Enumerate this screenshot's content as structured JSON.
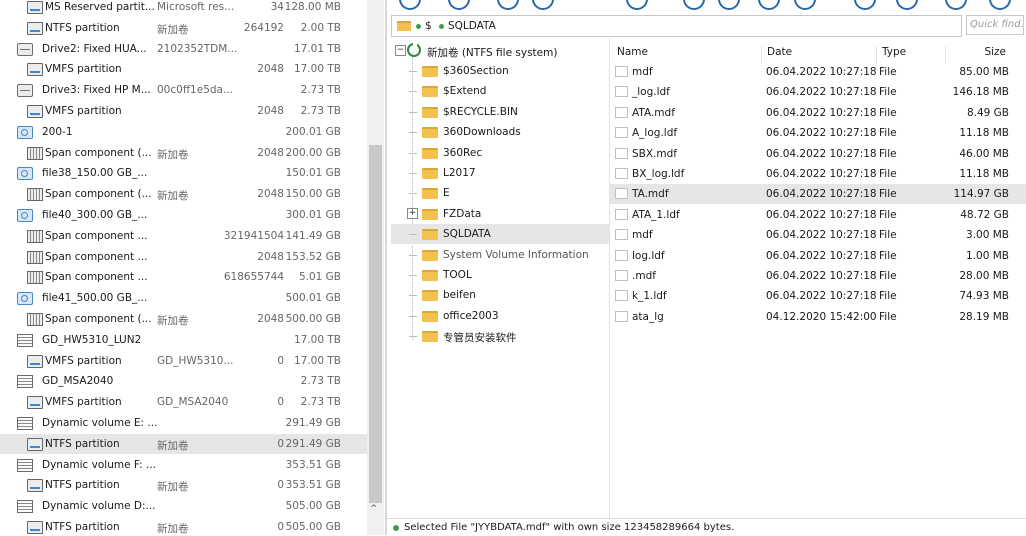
{
  "disks": [
    {
      "icon": "partition-icon",
      "name": "MS Reserved partit...",
      "desc": "Microsoft res...",
      "sectors": "34",
      "size": "128.00 MB",
      "indent": 1
    },
    {
      "icon": "partition-icon",
      "name": "NTFS partition",
      "desc": "新加卷",
      "sectors": "264192",
      "size": "2.00 TB",
      "indent": 1
    },
    {
      "icon": "drive-icon",
      "name": "Drive2: Fixed HUA...",
      "desc": "2102352TDM...",
      "sectors": "",
      "size": "17.01 TB",
      "indent": 0
    },
    {
      "icon": "partition-icon",
      "name": "VMFS partition",
      "desc": "",
      "sectors": "2048",
      "size": "17.00 TB",
      "indent": 1
    },
    {
      "icon": "drive-icon",
      "name": "Drive3: Fixed HP M...",
      "desc": "00c0ff1e5da...",
      "sectors": "",
      "size": "2.73 TB",
      "indent": 0
    },
    {
      "icon": "partition-icon",
      "name": "VMFS partition",
      "desc": "",
      "sectors": "2048",
      "size": "2.73 TB",
      "indent": 1
    },
    {
      "icon": "image-file-icon",
      "name": "200-1",
      "desc": "",
      "sectors": "",
      "size": "200.01 GB",
      "indent": 0
    },
    {
      "icon": "span-icon",
      "name": "Span component (...",
      "desc": "新加卷",
      "sectors": "2048",
      "size": "200.00 GB",
      "indent": 1
    },
    {
      "icon": "image-file-icon",
      "name": "file38_150.00 GB_...",
      "desc": "",
      "sectors": "",
      "size": "150.01 GB",
      "indent": 0
    },
    {
      "icon": "span-icon",
      "name": "Span component (...",
      "desc": "新加卷",
      "sectors": "2048",
      "size": "150.00 GB",
      "indent": 1
    },
    {
      "icon": "image-file-icon",
      "name": "file40_300.00 GB_...",
      "desc": "",
      "sectors": "",
      "size": "300.01 GB",
      "indent": 0
    },
    {
      "icon": "span-icon",
      "name": "Span component ...",
      "desc": "",
      "sectors": "321941504",
      "size": "141.49 GB",
      "indent": 1
    },
    {
      "icon": "span-icon",
      "name": "Span component ...",
      "desc": "",
      "sectors": "2048",
      "size": "153.52 GB",
      "indent": 1
    },
    {
      "icon": "span-icon",
      "name": "Span component ...",
      "desc": "",
      "sectors": "618655744",
      "size": "5.01 GB",
      "indent": 1
    },
    {
      "icon": "image-file-icon",
      "name": "file41_500.00 GB_...",
      "desc": "",
      "sectors": "",
      "size": "500.01 GB",
      "indent": 0
    },
    {
      "icon": "span-icon",
      "name": "Span component (...",
      "desc": "新加卷",
      "sectors": "2048",
      "size": "500.00 GB",
      "indent": 1
    },
    {
      "icon": "volume-icon",
      "name": "GD_HW5310_LUN2",
      "desc": "",
      "sectors": "",
      "size": "17.00 TB",
      "indent": 0
    },
    {
      "icon": "partition-icon",
      "name": "VMFS partition",
      "desc": "GD_HW5310...",
      "sectors": "0",
      "size": "17.00 TB",
      "indent": 1
    },
    {
      "icon": "volume-icon",
      "name": "GD_MSA2040",
      "desc": "",
      "sectors": "",
      "size": "2.73 TB",
      "indent": 0
    },
    {
      "icon": "partition-icon",
      "name": "VMFS partition",
      "desc": "GD_MSA2040",
      "sectors": "0",
      "size": "2.73 TB",
      "indent": 1
    },
    {
      "icon": "volume-icon",
      "name": "Dynamic volume E: ...",
      "desc": "",
      "sectors": "",
      "size": "291.49 GB",
      "indent": 0
    },
    {
      "icon": "partition-icon",
      "name": "NTFS partition",
      "desc": "新加卷",
      "sectors": "0",
      "size": "291.49 GB",
      "indent": 1,
      "selected": true
    },
    {
      "icon": "volume-icon",
      "name": "Dynamic volume F: ...",
      "desc": "",
      "sectors": "",
      "size": "353.51 GB",
      "indent": 0
    },
    {
      "icon": "partition-icon",
      "name": "NTFS partition",
      "desc": "新加卷",
      "sectors": "0",
      "size": "353.51 GB",
      "indent": 1
    },
    {
      "icon": "volume-icon",
      "name": "Dynamic volume D:...",
      "desc": "",
      "sectors": "",
      "size": "505.00 GB",
      "indent": 0
    },
    {
      "icon": "partition-icon",
      "name": "NTFS partition",
      "desc": "新加卷",
      "sectors": "0",
      "size": "505.00 GB",
      "indent": 1
    }
  ],
  "address": {
    "seg1": "$",
    "seg2": "SQLDATA"
  },
  "quick_find": {
    "placeholder": "Quick find..."
  },
  "tree": {
    "root_label": "新加卷 (NTFS file system)",
    "root_expander": "−",
    "folders": [
      {
        "label": "$360Section"
      },
      {
        "label": "$Extend"
      },
      {
        "label": "$RECYCLE.BIN"
      },
      {
        "label": "360Downloads"
      },
      {
        "label": "360Rec"
      },
      {
        "label": "L2017"
      },
      {
        "label": "E"
      },
      {
        "label": "FZData",
        "expander": "+"
      },
      {
        "label": "SQLDATA",
        "selected": true
      },
      {
        "label": "System Volume Information",
        "gray": true
      },
      {
        "label": "TOOL"
      },
      {
        "label": "beifen"
      },
      {
        "label": "office2003"
      },
      {
        "label": "专管员安装软件"
      }
    ]
  },
  "files": {
    "columns": {
      "name": "Name",
      "date": "Date",
      "type": "Type",
      "size": "Size"
    },
    "rows": [
      {
        "name": "mdf",
        "date": "06.04.2022 10:27:18",
        "type": "File",
        "size": "85.00 MB"
      },
      {
        "name": "_log.ldf",
        "date": "06.04.2022 10:27:18",
        "type": "File",
        "size": "146.18 MB"
      },
      {
        "name": "ATA.mdf",
        "date": "06.04.2022 10:27:18",
        "type": "File",
        "size": "8.49 GB"
      },
      {
        "name": "A_log.ldf",
        "date": "06.04.2022 10:27:18",
        "type": "File",
        "size": "11.18 MB"
      },
      {
        "name": "SBX.mdf",
        "date": "06.04.2022 10:27:18",
        "type": "File",
        "size": "46.00 MB"
      },
      {
        "name": "BX_log.ldf",
        "date": "06.04.2022 10:27:18",
        "type": "File",
        "size": "11.18 MB"
      },
      {
        "name": "TA.mdf",
        "date": "06.04.2022 10:27:18",
        "type": "File",
        "size": "114.97 GB",
        "selected": true
      },
      {
        "name": "ATA_1.ldf",
        "date": "06.04.2022 10:27:18",
        "type": "File",
        "size": "48.72 GB"
      },
      {
        "name": "mdf",
        "date": "06.04.2022 10:27:18",
        "type": "File",
        "size": "3.00 MB"
      },
      {
        "name": "log.ldf",
        "date": "06.04.2022 10:27:18",
        "type": "File",
        "size": "1.00 MB"
      },
      {
        "name": ".mdf",
        "date": "06.04.2022 10:27:18",
        "type": "File",
        "size": "28.00 MB"
      },
      {
        "name": "k_1.ldf",
        "date": "06.04.2022 10:27:18",
        "type": "File",
        "size": "74.93 MB"
      },
      {
        "name": "ata_lg",
        "date": "04.12.2020 15:42:00",
        "type": "File",
        "size": "28.19 MB"
      }
    ]
  },
  "status": {
    "text": "Selected File \"JYYBDATA.mdf\" with own size 123458289664 bytes."
  }
}
